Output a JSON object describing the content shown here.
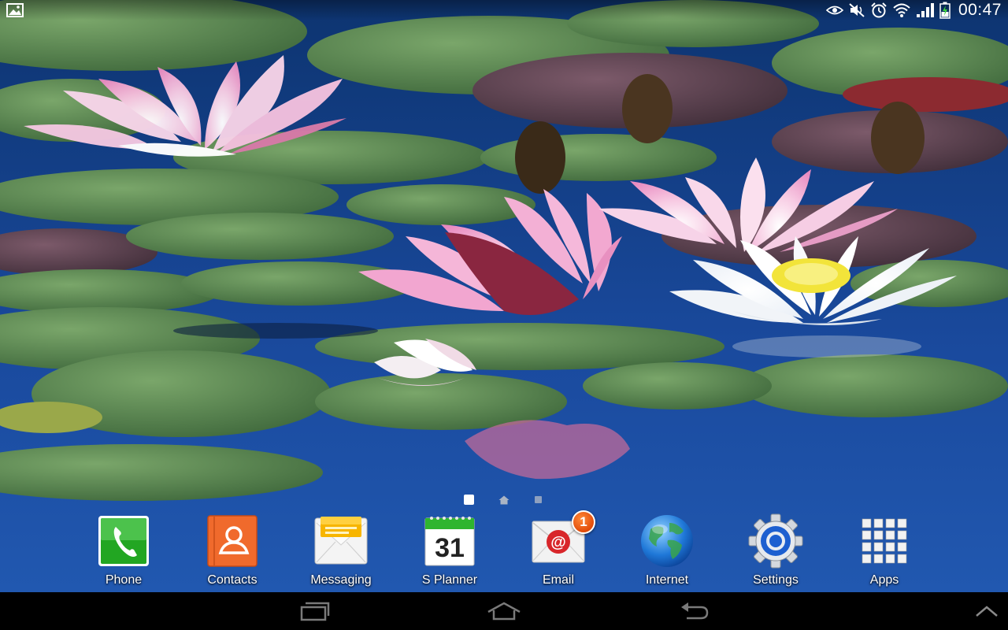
{
  "status_bar": {
    "time": "00:47",
    "left_icon": "gallery-notification-icon",
    "icons": [
      "smart-stay-eye-icon",
      "mute-icon",
      "alarm-icon",
      "wifi-icon",
      "signal-icon",
      "battery-charging-icon"
    ]
  },
  "page_indicator": {
    "pages": 3,
    "current": 1,
    "home_page": 2
  },
  "dock": {
    "items": [
      {
        "label": "Phone",
        "icon": "phone-icon"
      },
      {
        "label": "Contacts",
        "icon": "contacts-icon"
      },
      {
        "label": "Messaging",
        "icon": "messaging-icon"
      },
      {
        "label": "S Planner",
        "icon": "calendar-icon",
        "icon_text": "31"
      },
      {
        "label": "Email",
        "icon": "email-icon",
        "badge": "1"
      },
      {
        "label": "Internet",
        "icon": "globe-icon"
      },
      {
        "label": "Settings",
        "icon": "gear-icon"
      },
      {
        "label": "Apps",
        "icon": "apps-grid-icon"
      }
    ]
  },
  "nav_bar": {
    "icons": [
      "recent-apps-icon",
      "home-icon",
      "back-icon",
      "chevron-up-icon"
    ]
  },
  "colors": {
    "water": "#1b4aa0",
    "lily_pad": "#4f7d4a",
    "lily_pink": "#f2b4d6",
    "phone_green": "#2cae2c",
    "contacts_orange": "#f0662a",
    "email_red": "#d8262a",
    "nav_bar": "#000000"
  }
}
